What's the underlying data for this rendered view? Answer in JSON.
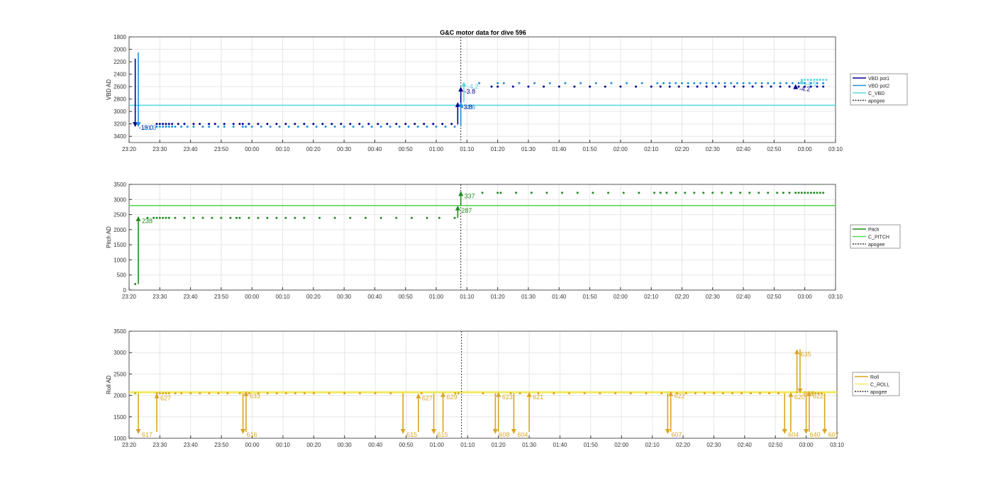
{
  "figure": {
    "title": "G&C motor data for dive 596"
  },
  "time_ticks": [
    "23:20",
    "23:30",
    "23:40",
    "23:50",
    "00:00",
    "00:10",
    "00:20",
    "00:30",
    "00:40",
    "00:50",
    "01:00",
    "01:10",
    "01:20",
    "01:30",
    "01:40",
    "01:50",
    "02:00",
    "02:10",
    "02:20",
    "02:30",
    "02:40",
    "02:50",
    "03:00",
    "03:10"
  ],
  "colors": {
    "vbd_pot1": "#00008b",
    "vbd_pot2": "#1f8fe0",
    "c_vbd": "#5ad8e0",
    "pitch": "#1e8c1e",
    "c_pitch": "#58d858",
    "roll": "#d9a520",
    "c_roll": "#f0e860",
    "apogee": "#333333",
    "grid": "#e6e6e6",
    "axis": "#333333"
  },
  "chart_data": [
    {
      "type": "scatter",
      "name": "vbd",
      "ylabel": "VBD AD",
      "x_unit": "clock time (HH:MM)",
      "xlim": [
        "23:20",
        "03:10"
      ],
      "ylim": [
        1800,
        3500
      ],
      "y_reversed": true,
      "yticks": [
        1800,
        2000,
        2200,
        2400,
        2600,
        2800,
        3000,
        3200,
        3400
      ],
      "grid": true,
      "legend": {
        "position": "right",
        "entries": [
          "VBD pot1",
          "VBD pot2",
          "C_VBD",
          "apogee"
        ]
      },
      "apogee_x": "01:08",
      "c_line": {
        "name": "C_VBD",
        "value": 2900
      },
      "series": [
        {
          "name": "VBD pot1",
          "color": "vbd_pot1",
          "y": 3200,
          "x": [
            "23:29",
            "23:30",
            "23:31",
            "23:32",
            "23:33",
            "23:34",
            "23:36",
            "23:38",
            "23:41",
            "23:43",
            "23:46",
            "23:48",
            "23:51",
            "23:54",
            "23:56",
            "23:57",
            "23:59",
            "00:02",
            "00:05",
            "00:08",
            "00:11",
            "00:14",
            "00:17",
            "00:20",
            "00:23",
            "00:26",
            "00:29",
            "00:32",
            "00:35",
            "00:38",
            "00:41",
            "00:44",
            "00:47",
            "00:50",
            "00:53",
            "00:56",
            "00:59",
            "01:02",
            "01:05"
          ]
        },
        {
          "name": "VBD pot2",
          "color": "vbd_pot2",
          "y": 3245,
          "x": [
            "23:29",
            "23:30",
            "23:31",
            "23:32",
            "23:33",
            "23:34",
            "23:35",
            "23:37",
            "23:39",
            "23:41",
            "23:44",
            "23:46",
            "23:49",
            "23:51",
            "23:54",
            "23:57",
            "23:58",
            "00:00",
            "00:03",
            "00:06",
            "00:09",
            "00:12",
            "00:15",
            "00:18",
            "00:21",
            "00:24",
            "00:27",
            "00:30",
            "00:33",
            "00:36",
            "00:39",
            "00:42",
            "00:45",
            "00:48",
            "00:51",
            "00:54",
            "00:57",
            "01:00",
            "01:03",
            "01:06"
          ]
        },
        {
          "name": "VBD pot1 (after apogee)",
          "color": "vbd_pot1",
          "y": 2600,
          "x": [
            "01:18",
            "01:20",
            "01:25",
            "01:30",
            "01:35",
            "01:40",
            "01:45",
            "01:50",
            "01:55",
            "02:00",
            "02:05",
            "02:10",
            "02:13",
            "02:16",
            "02:19",
            "02:22",
            "02:25",
            "02:28",
            "02:31",
            "02:34",
            "02:37",
            "02:40",
            "02:43",
            "02:46",
            "02:49",
            "02:52",
            "02:55",
            "02:57",
            "02:58",
            "03:00",
            "03:02",
            "03:04",
            "03:06"
          ]
        },
        {
          "name": "VBD pot2 (after apogee)",
          "color": "vbd_pot2",
          "y": 2545,
          "x": [
            "01:14",
            "01:20",
            "01:22",
            "01:27",
            "01:32",
            "01:37",
            "01:42",
            "01:47",
            "01:52",
            "01:57",
            "02:02",
            "02:07",
            "02:12",
            "02:14",
            "02:16",
            "02:18",
            "02:20",
            "02:22",
            "02:24",
            "02:26",
            "02:28",
            "02:30",
            "02:32",
            "02:34",
            "02:36",
            "02:38",
            "02:40",
            "02:42",
            "02:44",
            "02:46",
            "02:48",
            "02:50",
            "02:52",
            "02:54",
            "02:56",
            "02:58",
            "03:00",
            "03:02",
            "03:04",
            "03:06"
          ]
        },
        {
          "name": "C_VBD (after apogee)",
          "color": "c_vbd",
          "y": 2490,
          "x": [
            "02:59",
            "03:00",
            "03:01",
            "03:02",
            "03:03",
            "03:04",
            "03:05",
            "03:06",
            "03:07"
          ]
        }
      ],
      "arrows": [
        {
          "x": "23:22",
          "y_from": 2150,
          "y_to": 3250,
          "color": "vbd_pot1",
          "label": "-19.0"
        },
        {
          "x": "23:23",
          "y_from": 2050,
          "y_to": 3250,
          "color": "vbd_pot2",
          "label": "-21.3"
        },
        {
          "x": "01:07",
          "y_from": 3210,
          "y_to": 2850,
          "color": "vbd_pot1",
          "label": "-3.8"
        },
        {
          "x": "01:08",
          "y_from": 2880,
          "y_to": 2600,
          "color": "vbd_pot1",
          "label": "-3.8"
        },
        {
          "x": "01:08",
          "y_from": 3240,
          "y_to": 2850,
          "color": "vbd_pot2",
          "label": "-4.6"
        },
        {
          "x": "01:09",
          "y_from": 2850,
          "y_to": 2520,
          "color": "c_vbd",
          "label": "-4.2"
        },
        {
          "x": "02:57",
          "y_from": 2600,
          "y_to": 2560,
          "color": "vbd_pot1",
          "label": "-4.2"
        },
        {
          "x": "02:59",
          "y_from": 2560,
          "y_to": 2480,
          "color": "c_vbd",
          "label": "-4.5"
        }
      ]
    },
    {
      "type": "scatter",
      "name": "pitch",
      "ylabel": "Pitch AD",
      "x_unit": "clock time (HH:MM)",
      "xlim": [
        "23:20",
        "03:10"
      ],
      "ylim": [
        0,
        3500
      ],
      "yticks": [
        0,
        500,
        1000,
        1500,
        2000,
        2500,
        3000,
        3500
      ],
      "grid": true,
      "legend": {
        "position": "right",
        "entries": [
          "Pitch",
          "C_PITCH",
          "apogee"
        ]
      },
      "apogee_x": "01:08",
      "c_line": {
        "name": "C_PITCH",
        "value": 2800
      },
      "series": [
        {
          "name": "Pitch",
          "color": "pitch",
          "y": 2390,
          "x": [
            "23:26",
            "23:28",
            "23:29",
            "23:30",
            "23:31",
            "23:32",
            "23:33",
            "23:35",
            "23:38",
            "23:41",
            "23:44",
            "23:47",
            "23:50",
            "23:53",
            "23:55",
            "23:56",
            "23:59",
            "00:02",
            "00:05",
            "00:08",
            "00:11",
            "00:14",
            "00:17",
            "00:22",
            "00:27",
            "00:32",
            "00:37",
            "00:42",
            "00:47",
            "00:52",
            "00:57",
            "01:01",
            "01:06"
          ]
        },
        {
          "name": "Pitch (after apogee)",
          "color": "pitch",
          "y": 3220,
          "x": [
            "01:15",
            "01:20",
            "01:21",
            "01:26",
            "01:31",
            "01:36",
            "01:41",
            "01:46",
            "01:51",
            "01:56",
            "02:01",
            "02:06",
            "02:11",
            "02:13",
            "02:15",
            "02:18",
            "02:21",
            "02:24",
            "02:27",
            "02:30",
            "02:33",
            "02:36",
            "02:39",
            "02:42",
            "02:45",
            "02:48",
            "02:51",
            "02:53",
            "02:55",
            "02:57",
            "02:58",
            "02:59",
            "03:00",
            "03:01",
            "03:02",
            "03:03",
            "03:04",
            "03:05",
            "03:06"
          ]
        },
        {
          "name": "Pitch start",
          "color": "pitch",
          "y": 200,
          "x": [
            "23:22"
          ]
        }
      ],
      "arrows": [
        {
          "x": "23:23",
          "y_from": 200,
          "y_to": 2450,
          "color": "pitch",
          "label": "238"
        },
        {
          "x": "01:07",
          "y_from": 2390,
          "y_to": 2800,
          "color": "pitch",
          "label": "287"
        },
        {
          "x": "01:08",
          "y_from": 2800,
          "y_to": 3280,
          "color": "pitch",
          "label": "337"
        }
      ]
    },
    {
      "type": "scatter",
      "name": "roll",
      "ylabel": "Roll AD",
      "x_unit": "clock time (HH:MM)",
      "xlim": [
        "23:20",
        "03:10"
      ],
      "ylim": [
        1000,
        3500
      ],
      "yticks": [
        1000,
        1500,
        2000,
        2500,
        3000,
        3500
      ],
      "grid": true,
      "legend": {
        "position": "right",
        "entries": [
          "Roll",
          "C_ROLL",
          "apogee"
        ]
      },
      "apogee_x": "01:08",
      "c_line": {
        "name": "C_ROLL",
        "value": 2075
      },
      "series": [
        {
          "name": "Roll",
          "color": "roll",
          "y": 2050,
          "x": [
            "23:22",
            "23:29",
            "23:30",
            "23:31",
            "23:32",
            "23:33",
            "23:35",
            "23:37",
            "23:40",
            "23:43",
            "23:46",
            "23:49",
            "23:52",
            "23:56",
            "23:59",
            "00:02",
            "00:05",
            "00:08",
            "00:11",
            "00:14",
            "00:17",
            "00:20",
            "00:25",
            "00:30",
            "00:35",
            "00:40",
            "00:45",
            "00:55",
            "01:06",
            "01:07",
            "01:15",
            "01:24",
            "01:27",
            "01:33",
            "01:38",
            "01:43",
            "01:48",
            "01:53",
            "01:58",
            "02:03",
            "02:08",
            "02:13",
            "02:18",
            "02:21",
            "02:24",
            "02:27",
            "02:30",
            "02:33",
            "02:36",
            "02:39",
            "02:42",
            "02:45",
            "02:48",
            "02:51",
            "03:02",
            "03:03",
            "03:04",
            "03:05"
          ]
        }
      ],
      "arrows": [
        {
          "x": "23:23",
          "y_from": 2050,
          "y_to": 1100,
          "color": "roll",
          "label": "617"
        },
        {
          "x": "23:29",
          "y_from": 1150,
          "y_to": 2050,
          "color": "roll",
          "label": "627"
        },
        {
          "x": "23:57",
          "y_from": 2050,
          "y_to": 1100,
          "color": "roll",
          "label": "616"
        },
        {
          "x": "23:58",
          "y_from": 1150,
          "y_to": 2100,
          "color": "roll",
          "label": "633"
        },
        {
          "x": "00:49",
          "y_from": 2050,
          "y_to": 1100,
          "color": "roll",
          "label": "615"
        },
        {
          "x": "00:54",
          "y_from": 1150,
          "y_to": 2050,
          "color": "roll",
          "label": "627"
        },
        {
          "x": "00:59",
          "y_from": 2050,
          "y_to": 1100,
          "color": "roll",
          "label": "615"
        },
        {
          "x": "01:02",
          "y_from": 1150,
          "y_to": 2080,
          "color": "roll",
          "label": "629"
        },
        {
          "x": "01:19",
          "y_from": 2050,
          "y_to": 1100,
          "color": "roll",
          "label": "608"
        },
        {
          "x": "01:20",
          "y_from": 1150,
          "y_to": 2080,
          "color": "roll",
          "label": "623"
        },
        {
          "x": "01:25",
          "y_from": 2050,
          "y_to": 1100,
          "color": "roll",
          "label": "604"
        },
        {
          "x": "01:30",
          "y_from": 1150,
          "y_to": 2080,
          "color": "roll",
          "label": "621"
        },
        {
          "x": "02:15",
          "y_from": 2050,
          "y_to": 1100,
          "color": "roll",
          "label": "607"
        },
        {
          "x": "02:16",
          "y_from": 1150,
          "y_to": 2100,
          "color": "roll",
          "label": "622"
        },
        {
          "x": "02:53",
          "y_from": 2050,
          "y_to": 1100,
          "color": "roll",
          "label": "604"
        },
        {
          "x": "02:55",
          "y_from": 1150,
          "y_to": 2080,
          "color": "roll",
          "label": "620"
        },
        {
          "x": "02:57",
          "y_from": 2050,
          "y_to": 3080,
          "color": "roll",
          "label": "635"
        },
        {
          "x": "02:58",
          "y_from": 3080,
          "y_to": 2050,
          "color": "roll",
          "label": "607"
        },
        {
          "x": "03:00",
          "y_from": 2050,
          "y_to": 1100,
          "color": "roll",
          "label": "640"
        },
        {
          "x": "03:01",
          "y_from": 1150,
          "y_to": 2100,
          "color": "roll",
          "label": "622"
        },
        {
          "x": "03:06",
          "y_from": 2050,
          "y_to": 1100,
          "color": "roll",
          "label": "607"
        }
      ]
    }
  ]
}
